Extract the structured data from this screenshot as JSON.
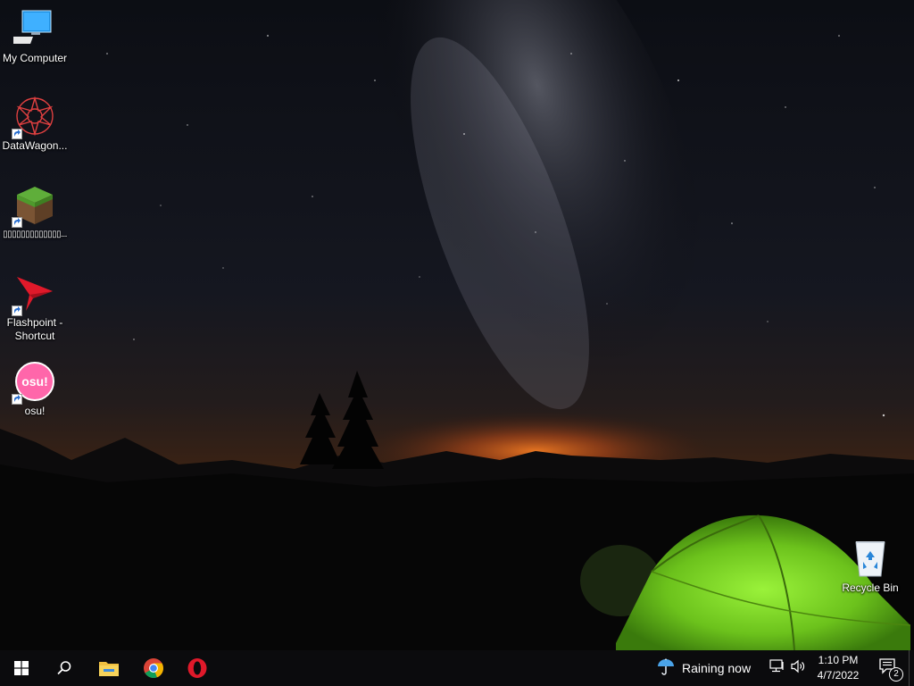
{
  "desktop": {
    "icons": [
      {
        "label": "My Computer",
        "icon": "computer-icon",
        "shortcut": false
      },
      {
        "label": "DataWagon...",
        "icon": "datawagon-icon",
        "shortcut": true
      },
      {
        "label": "▯▯▯▯▯▯▯▯▯▯▯▯▯...",
        "icon": "minecraft-grass-block-icon",
        "shortcut": true
      },
      {
        "label": "Flashpoint - Shortcut",
        "icon": "flashpoint-icon",
        "shortcut": true
      },
      {
        "label": "osu!",
        "icon": "osu-icon",
        "shortcut": true,
        "glyph_text": "osu!"
      },
      {
        "label": "Recycle Bin",
        "icon": "recycle-bin-icon",
        "shortcut": false
      }
    ]
  },
  "taskbar": {
    "start": "windows-start-icon",
    "search": "search-icon",
    "pinned": [
      {
        "name": "file-explorer",
        "icon": "folder-icon"
      },
      {
        "name": "chrome",
        "icon": "chrome-icon"
      },
      {
        "name": "opera",
        "icon": "opera-icon"
      }
    ],
    "weather_text": "Raining now",
    "weather_icon": "umbrella-icon",
    "network_icon": "network-icon",
    "volume_icon": "volume-icon",
    "clock_time": "1:10 PM",
    "clock_date": "4/7/2022",
    "notification_count": "2"
  },
  "colors": {
    "taskbar_bg": "#0b0b0d",
    "tent": "#7ed321",
    "horizon_glow": "#e86a1e",
    "osu_pink": "#ff66aa",
    "flashpoint_red": "#e0192a"
  }
}
